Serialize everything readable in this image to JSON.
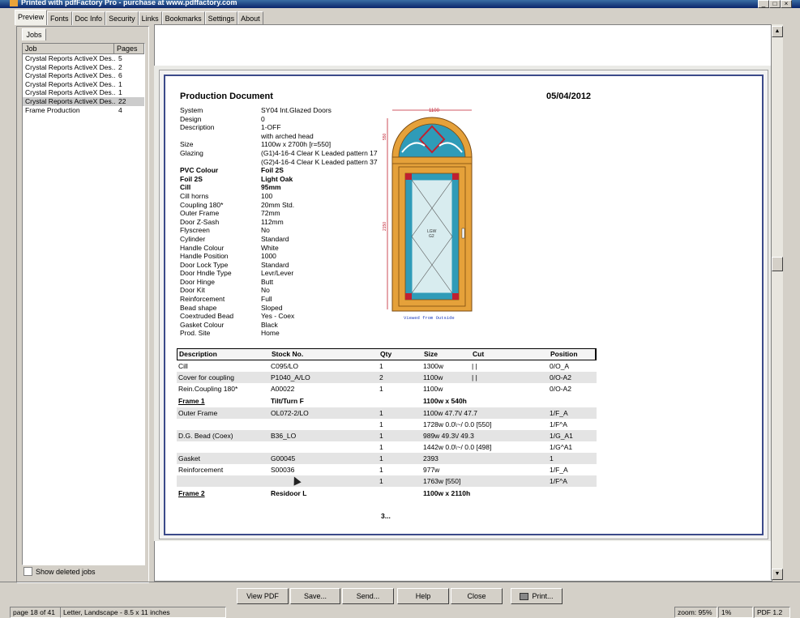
{
  "window": {
    "title": "Printed with pdfFactory Pro - purchase at www.pdffactory.com"
  },
  "tabs": [
    "Preview",
    "Fonts",
    "Doc Info",
    "Security",
    "Links",
    "Bookmarks",
    "Settings",
    "About"
  ],
  "jobs_panel": {
    "tab_label": "Jobs",
    "col_job": "Job",
    "col_pages": "Pages",
    "rows": [
      {
        "job": "Crystal Reports ActiveX Des...",
        "pages": "5"
      },
      {
        "job": "Crystal Reports ActiveX Des...",
        "pages": "2"
      },
      {
        "job": "Crystal Reports ActiveX Des...",
        "pages": "6"
      },
      {
        "job": "Crystal Reports ActiveX Des...",
        "pages": "1"
      },
      {
        "job": "Crystal Reports ActiveX Des...",
        "pages": "1"
      },
      {
        "job": "Crystal Reports ActiveX Des...",
        "pages": "22"
      },
      {
        "job": "Frame Production",
        "pages": "4"
      }
    ],
    "selected_index": 5,
    "show_deleted_label": "Show deleted jobs"
  },
  "document": {
    "title": "Production Document",
    "date": "05/04/2012",
    "properties": [
      {
        "k": "System",
        "v": "SY04  Int.Glazed Doors",
        "bold": false
      },
      {
        "k": "Design",
        "v": "0",
        "bold": false
      },
      {
        "k": "Description",
        "v": "1-OFF",
        "bold": false
      },
      {
        "k": "",
        "v": "with arched head",
        "bold": false
      },
      {
        "k": "Size",
        "v": "1100w x 2700h [r=550]",
        "bold": false
      },
      {
        "k": "Glazing",
        "v": "(G1)4-16-4 Clear K Leaded pattern 17",
        "bold": false
      },
      {
        "k": "",
        "v": "(G2)4-16-4 Clear K Leaded pattern 37",
        "bold": false
      },
      {
        "k": "PVC Colour",
        "v": "Foil 2S",
        "bold": true
      },
      {
        "k": "Foil 2S",
        "v": "Light Oak",
        "bold": true
      },
      {
        "k": "Cill",
        "v": "95mm",
        "bold": true
      },
      {
        "k": "Cill horns",
        "v": "100",
        "bold": false
      },
      {
        "k": "Coupling 180*",
        "v": "20mm Std.",
        "bold": false
      },
      {
        "k": "Outer Frame",
        "v": "72mm",
        "bold": false
      },
      {
        "k": "Door Z-Sash",
        "v": "112mm",
        "bold": false
      },
      {
        "k": "Flyscreen",
        "v": "No",
        "bold": false
      },
      {
        "k": "Cylinder",
        "v": "Standard",
        "bold": false
      },
      {
        "k": "Handle Colour",
        "v": "White",
        "bold": false
      },
      {
        "k": "Handle Position",
        "v": "1000",
        "bold": false
      },
      {
        "k": "Door Lock Type",
        "v": "Standard",
        "bold": false
      },
      {
        "k": "Door Hndle Type",
        "v": "Levr/Lever",
        "bold": false
      },
      {
        "k": "Door Hinge",
        "v": "Butt",
        "bold": false
      },
      {
        "k": "Door Kit",
        "v": "No",
        "bold": false
      },
      {
        "k": "Reinforcement",
        "v": "Full",
        "bold": false
      },
      {
        "k": "Bead shape",
        "v": "Sloped",
        "bold": false
      },
      {
        "k": "Coextruded Bead",
        "v": "Yes - Coex",
        "bold": false
      },
      {
        "k": "Gasket Colour",
        "v": "Black",
        "bold": false
      },
      {
        "k": "Prod. Site",
        "v": "Home",
        "bold": false
      }
    ],
    "drawing": {
      "width_label": "1100",
      "height_label_top": "550",
      "height_label_main": "2150",
      "pane_label_1": "LGW",
      "pane_label_2": "G2",
      "caption": "Viewed from Outside"
    },
    "table": {
      "headers": [
        "Description",
        "Stock No.",
        "Qty",
        "Size",
        "Cut",
        "Position"
      ],
      "rows": [
        {
          "type": "row",
          "shade": false,
          "c": [
            "Cill",
            "C095/LO",
            "1",
            "1300w",
            "| |",
            "0/O_A"
          ]
        },
        {
          "type": "row",
          "shade": true,
          "c": [
            "Cover for coupling",
            "P1040_A/LO",
            "2",
            "1100w",
            "| |",
            "0/O-A2"
          ]
        },
        {
          "type": "row",
          "shade": false,
          "c": [
            "Rein.Coupling 180*",
            "A00022",
            "1",
            "1100w",
            "",
            "0/O-A2"
          ]
        },
        {
          "type": "frame",
          "shade": false,
          "c": [
            "Frame 1",
            "Tilt/Turn F",
            "",
            "1100w x 540h",
            "",
            ""
          ]
        },
        {
          "type": "row",
          "shade": true,
          "c": [
            "Outer Frame",
            "OL072-2/LO",
            "1",
            "1100w  47.7\\/  47.7",
            "",
            "1/F_A"
          ]
        },
        {
          "type": "row",
          "shade": false,
          "c": [
            "",
            "",
            "1",
            "1728w  0.0\\~/  0.0 [550]",
            "",
            "1/F^A"
          ]
        },
        {
          "type": "row",
          "shade": true,
          "c": [
            "D.G. Bead (Coex)",
            "B36_LO",
            "1",
            "989w  49.3\\/  49.3",
            "",
            "1/G_A1"
          ]
        },
        {
          "type": "row",
          "shade": false,
          "c": [
            "",
            "",
            "1",
            "1442w  0.0\\~/  0.0 [498]",
            "",
            "1/G^A1"
          ]
        },
        {
          "type": "row",
          "shade": true,
          "c": [
            "Gasket",
            "G00045",
            "1",
            "2393",
            "",
            "1"
          ]
        },
        {
          "type": "row",
          "shade": false,
          "c": [
            "Reinforcement",
            "S00036",
            "1",
            "977w",
            "",
            "1/F_A"
          ]
        },
        {
          "type": "row",
          "shade": true,
          "c": [
            "",
            "",
            "1",
            "1763w [550]",
            "",
            "1/F^A"
          ]
        },
        {
          "type": "frame",
          "shade": false,
          "c": [
            "Frame 2",
            "Residoor L",
            "",
            "1100w x 2110h",
            "",
            ""
          ]
        }
      ]
    },
    "page_marker": "3..."
  },
  "buttons": [
    "View PDF",
    "Save...",
    "Send...",
    "Help",
    "Close",
    "Print..."
  ],
  "status": {
    "page": "page 18 of 41",
    "paper": "Letter, Landscape - 8.5 x 11 inches",
    "zoom": "zoom: 95%",
    "percent": "1%",
    "pdf": "PDF 1.2"
  },
  "colors": {
    "frame_wood": "#e5a13a",
    "glass": "#2f9bb8",
    "lead": "#c02030",
    "page_border": "#3b4a8a"
  }
}
